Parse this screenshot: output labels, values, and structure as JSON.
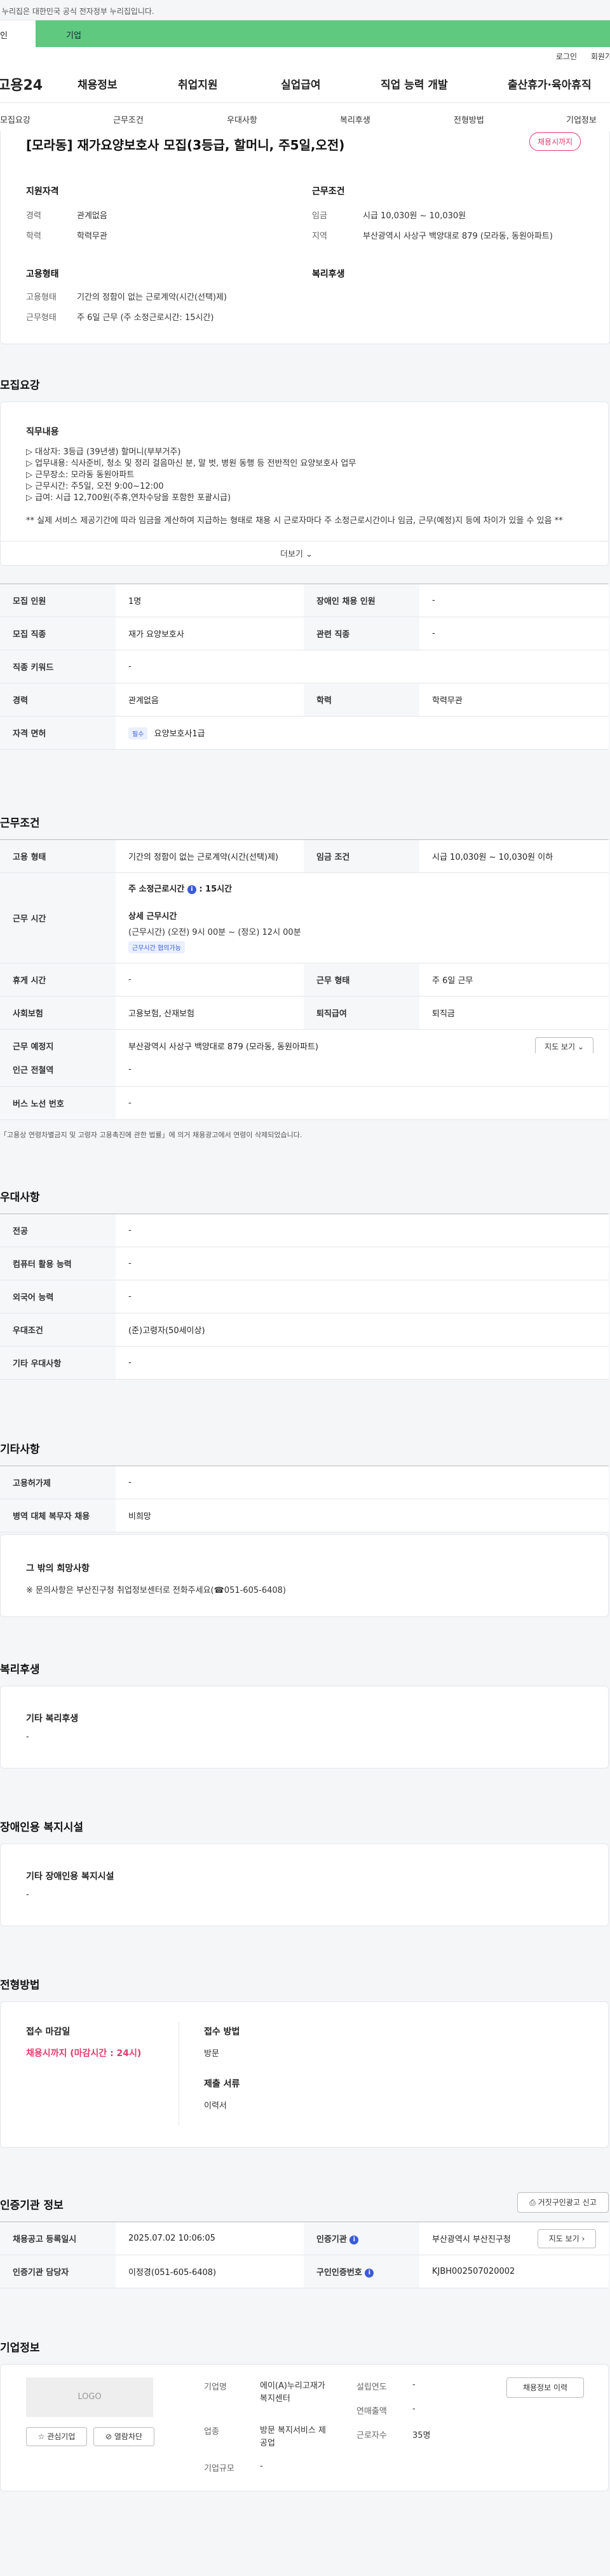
{
  "topbar": {
    "notice": "이 누리집은 대한민국 공식 전자정부 누리집입니다."
  },
  "tabs": {
    "individual": "개인",
    "company": "기업"
  },
  "util": {
    "login": "로그인",
    "join": "회원가입"
  },
  "gnb": {
    "logo": "고용24",
    "items": [
      "채용정보",
      "취업지원",
      "실업급여",
      "직업 능력 개발",
      "출산휴가·육아휴직"
    ]
  },
  "snb": {
    "items": [
      "모집요강",
      "근무조건",
      "우대사항",
      "복리후생",
      "전형방법",
      "기업정보"
    ]
  },
  "summary": {
    "title": "[모라동] 재가요양보호사 모집(3등급, 할머니, 주5일,오전)",
    "badge": "채용시까지",
    "qual_title": "지원자격",
    "career_label": "경력",
    "career_value": "관계없음",
    "edu_label": "학력",
    "edu_value": "학력무관",
    "cond_title": "근무조건",
    "wage_label": "임금",
    "wage_value": "시급 10,030원 ~ 10,030원",
    "region_label": "지역",
    "region_value": "부산광역시 사상구 백양대로 879 (모라동, 동원아파트)",
    "emp_title": "고용형태",
    "emptype_label": "고용형태",
    "emptype_value": "기간의 정함이 없는 근로계약(시간(선택)제)",
    "worktype_label": "근무형태",
    "worktype_value": "주 6일 근무 (주 소정근로시간: 15시간)",
    "welfare_title": "복리후생"
  },
  "recruit": {
    "heading": "모집요강",
    "job_title": "직무내용",
    "lines": [
      "▷ 대상자:  3등급 (39년생) 할머니(부부거주)",
      "▷ 업무내용: 식사준비, 청소 및 정리 걸음마신 분, 말 벗, 병원 동행 등 전반적인 요양보호사 업무",
      "▷ 근무장소: 모라동 동원아파트",
      "▷ 근무시간:  주5일,  오전 9:00~12:00",
      "▷ 급여: 시급 12,700원(주휴,연차수당을 포함한 포괄시급)",
      "",
      "** 실제 서비스 제공기간에 따라 임금을 계산하여 지급하는 형태로 채용 시 근로자마다 주 소정근로시간이나 임금, 근무(예정)지 등에 차이가 있을 수 있음 **"
    ],
    "more": "더보기",
    "table": {
      "count_label": "모집 인원",
      "count_value": "1명",
      "disabled_label": "장애인 채용 인원",
      "disabled_value": "-",
      "job_label": "모집 직종",
      "job_value": "재가 요양보호사",
      "related_label": "관련 직종",
      "related_value": "-",
      "keyword_label": "직종 키워드",
      "keyword_value": "-",
      "career_label": "경력",
      "career_value": "관계없음",
      "edu_label": "학력",
      "edu_value": "학력무관",
      "license_label": "자격 면허",
      "license_tag": "필수",
      "license_value": "요양보호사1급"
    }
  },
  "work": {
    "heading": "근무조건",
    "emp_label": "고용 형태",
    "emp_value": "기간의 정함이 없는 근로계약(시간(선택)제)",
    "wage_label": "임금 조건",
    "wage_value": "시급 10,030원 ~ 10,030원 이하",
    "time_label": "근무 시간",
    "weekly_label": "주 소정근로시간",
    "weekly_value": ": 15시간",
    "detail_label": "상세 근무시간",
    "detail_value": "(근무시간) (오전) 9시 00분 ~ (정오) 12시 00분",
    "nego_chip": "근무시간 협의가능",
    "rest_label": "휴게 시간",
    "rest_value": "-",
    "form_label": "근무 형태",
    "form_value": "주 6일 근무",
    "insurance_label": "사회보험",
    "insurance_value": "고용보험, 산재보험",
    "retire_label": "퇴직급여",
    "retire_value": "퇴직금",
    "place_label": "근무 예정지",
    "place_value": "부산광역시 사상구 백양대로 879 (모라동, 동원아파트)",
    "map_button": "지도 보기",
    "subway_label": "인근 전철역",
    "subway_value": "-",
    "bus_label": "버스 노선 번호",
    "bus_value": "-",
    "footnote": "「고용상 연령차별금지 및 고령자 고용촉진에 관한 법률」에 의거 채용광고에서 연령이 삭제되었습니다."
  },
  "pref": {
    "heading": "우대사항",
    "major_label": "전공",
    "major_value": "-",
    "computer_label": "컴퓨터 활용 능력",
    "computer_value": "-",
    "lang_label": "외국어 능력",
    "lang_value": "-",
    "pref_label": "우대조건",
    "pref_value": "(준)고령자(50세이상)",
    "etc_label": "기타 우대사항",
    "etc_value": "-"
  },
  "other": {
    "heading": "기타사항",
    "type_label": "고용허가제",
    "type_value": "-",
    "military_label": "병역 대체 복무자 채용",
    "military_value": "비희망",
    "wish_title": "그 밖의 희망사항",
    "wish_value": "※ 문의사항은 부산진구청 취업정보센터로 전화주세요(☎051-605-6408)"
  },
  "welfare": {
    "heading": "복리후생",
    "sub": "기타 복리후생",
    "value": "-"
  },
  "disabled": {
    "heading": "장애인용 복지시설",
    "sub": "기타 장애인용 복지시설",
    "value": "-"
  },
  "process": {
    "heading": "전형방법",
    "deadline_label": "접수 마감일",
    "deadline_value": "채용시까지 (마감시간 : 24시)",
    "method_label": "접수 방법",
    "method_value": "방문",
    "docs_label": "제출 서류",
    "docs_value": "이력서"
  },
  "cert": {
    "heading": "인증기관 정보",
    "report_button": "거짓구인광고 신고",
    "date_label": "채용공고 등록일시",
    "date_value": "2025.07.02 10:06:05",
    "agency_label": "인증기관",
    "agency_value": "부산광역시 부산진구청",
    "map_button": "지도 보기",
    "manager_label": "인증기관 담당자",
    "manager_value": "이정경(051-605-6408)",
    "reqno_label": "구인인증번호",
    "reqno_value": "KJBH002507020002"
  },
  "company": {
    "heading": "기업정보",
    "logo": "LOGO",
    "fav_button": "관심기업",
    "block_button": "열람차단",
    "name_label": "기업명",
    "name_value": "에이(A)누리고재가복지센터",
    "industry_label": "업종",
    "industry_value": "방문 복지서비스 제공업",
    "size_label": "기업규모",
    "size_value": "-",
    "founded_label": "설립연도",
    "founded_value": "-",
    "sales_label": "연매출액",
    "sales_value": "-",
    "staff_label": "근로자수",
    "staff_value": "35명",
    "history_button": "채용정보 이력"
  },
  "colors": {
    "green": "#5ec97f",
    "red": "#e5396f",
    "blue": "#3a5bd9"
  }
}
